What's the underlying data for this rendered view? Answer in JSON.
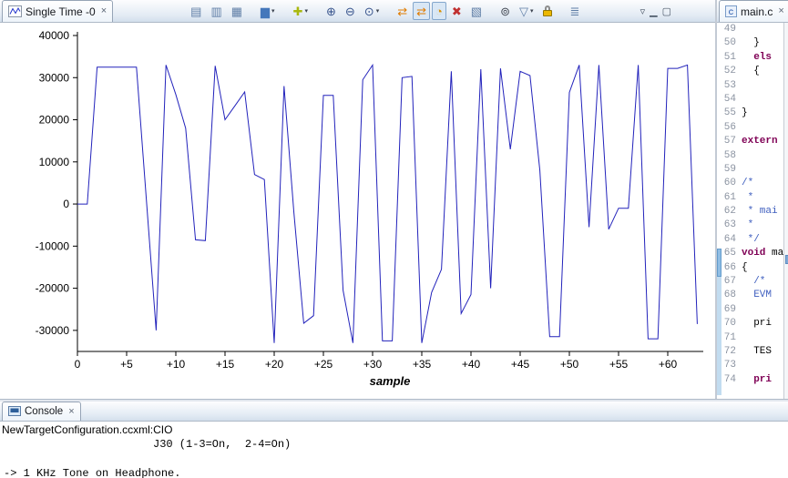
{
  "icons": {
    "close": "×",
    "dropdown": "▾"
  },
  "graph_pane": {
    "tab": {
      "label": "Single Time -0"
    },
    "toolbar": [
      {
        "name": "cursor-data-icon",
        "glyph": "▤",
        "color": "#5f7ea6"
      },
      {
        "name": "display-data-icon",
        "glyph": "▥",
        "color": "#5f7ea6"
      },
      {
        "name": "grid-toggle-icon",
        "glyph": "▦",
        "color": "#5f7ea6"
      },
      {
        "name": "signal-type-icon",
        "glyph": "▆",
        "color": "#4477bb",
        "dropdown": true,
        "gap": true
      },
      {
        "name": "add-graph-icon",
        "glyph": "✚",
        "color": "#a9b80e",
        "dropdown": true,
        "gap": true
      },
      {
        "name": "zoom-in-icon",
        "glyph": "⊕",
        "color": "#37538c",
        "gap": true
      },
      {
        "name": "zoom-out-icon",
        "glyph": "⊖",
        "color": "#37538c"
      },
      {
        "name": "zoom-mode-icon",
        "glyph": "⊙",
        "color": "#37538c",
        "dropdown": true
      },
      {
        "name": "refresh-icon",
        "glyph": "⇄",
        "color": "#e07b00",
        "gap": true
      },
      {
        "name": "continuous-refresh-icon",
        "glyph": "⇄",
        "color": "#e07b00",
        "pressed": true
      },
      {
        "name": "auto-scale-icon",
        "glyph": "◔",
        "color": "#d99000",
        "pressed": true
      },
      {
        "name": "clear-graph-icon",
        "glyph": "✖",
        "color": "#c03030"
      },
      {
        "name": "export-graph-icon",
        "glyph": "▧",
        "color": "#5f7ea6"
      },
      {
        "name": "search-icon",
        "glyph": "⊚",
        "color": "#444a55",
        "gap": true
      },
      {
        "name": "filter-icon",
        "glyph": "▽",
        "color": "#5f7ea6",
        "dropdown": true
      },
      {
        "name": "freeze-icon",
        "shape": "padlock"
      },
      {
        "name": "legend-icon",
        "glyph": "≣",
        "color": "#5f7ea6",
        "gap": true
      }
    ],
    "window_controls": [
      {
        "name": "view-menu-icon",
        "glyph": "▿"
      },
      {
        "name": "minimize-icon",
        "glyph": "▁"
      },
      {
        "name": "maximize-icon",
        "glyph": "▢"
      }
    ]
  },
  "chart_data": {
    "type": "line",
    "title": "",
    "xlabel": "sample",
    "ylabel": "",
    "grid": false,
    "legend": false,
    "line_color": "#2222bb",
    "xlim": [
      0,
      63
    ],
    "ylim": [
      -35000,
      40000
    ],
    "x_ticks": [
      {
        "v": 0,
        "label": "0"
      },
      {
        "v": 5,
        "label": "+5"
      },
      {
        "v": 10,
        "label": "+10"
      },
      {
        "v": 15,
        "label": "+15"
      },
      {
        "v": 20,
        "label": "+20"
      },
      {
        "v": 25,
        "label": "+25"
      },
      {
        "v": 30,
        "label": "+30"
      },
      {
        "v": 35,
        "label": "+35"
      },
      {
        "v": 40,
        "label": "+40"
      },
      {
        "v": 45,
        "label": "+45"
      },
      {
        "v": 50,
        "label": "+50"
      },
      {
        "v": 55,
        "label": "+55"
      },
      {
        "v": 60,
        "label": "+60"
      }
    ],
    "y_ticks": [
      40000,
      30000,
      20000,
      10000,
      0,
      -10000,
      -20000,
      -30000
    ],
    "x_start": 0,
    "values": [
      0,
      0,
      32500,
      32500,
      32500,
      32500,
      32500,
      1250,
      -30000,
      33000,
      26000,
      18000,
      -8500,
      -8700,
      32800,
      20000,
      23300,
      26600,
      7000,
      5800,
      -33000,
      28000,
      -2000,
      -28300,
      -26500,
      25800,
      25800,
      -20500,
      -33000,
      29500,
      33000,
      -32500,
      -32500,
      30000,
      30300,
      -33000,
      -21000,
      -15500,
      31500,
      -26000,
      -21500,
      32000,
      -20000,
      32200,
      13000,
      31500,
      30500,
      8000,
      -31500,
      -31500,
      26500,
      33000,
      -5500,
      33000,
      -6000,
      -1000,
      -1000,
      33000,
      -32000,
      -32000,
      32200,
      32200,
      33000,
      -28500
    ]
  },
  "editor_pane": {
    "tab": {
      "label": "main.c"
    },
    "start_line": 49,
    "range_indicator": {
      "start_line": 65,
      "marker_start": 65,
      "marker_end": 66
    },
    "styles": {
      "k": "keyword",
      "c": "comment",
      "p": "plain"
    },
    "lines": [
      {
        "segs": []
      },
      {
        "segs": [
          [
            "p",
            "  }"
          ]
        ]
      },
      {
        "segs": [
          [
            "p",
            "  "
          ],
          [
            "k",
            "els"
          ]
        ]
      },
      {
        "segs": [
          [
            "p",
            "  {"
          ]
        ]
      },
      {
        "segs": []
      },
      {
        "segs": []
      },
      {
        "segs": [
          [
            "p",
            "}"
          ]
        ]
      },
      {
        "segs": []
      },
      {
        "segs": [
          [
            "k",
            "extern"
          ]
        ]
      },
      {
        "segs": []
      },
      {
        "segs": []
      },
      {
        "segs": [
          [
            "c",
            "/*"
          ]
        ]
      },
      {
        "segs": [
          [
            "c",
            " *"
          ]
        ]
      },
      {
        "segs": [
          [
            "c",
            " * mai"
          ]
        ]
      },
      {
        "segs": [
          [
            "c",
            " *"
          ]
        ]
      },
      {
        "segs": [
          [
            "c",
            " */"
          ]
        ]
      },
      {
        "segs": [
          [
            "k",
            "void"
          ],
          [
            "p",
            " ma"
          ]
        ]
      },
      {
        "segs": [
          [
            "p",
            "{"
          ]
        ]
      },
      {
        "segs": [
          [
            "p",
            "  "
          ],
          [
            "c",
            "/*"
          ]
        ]
      },
      {
        "segs": [
          [
            "p",
            "  "
          ],
          [
            "c",
            "EVM"
          ]
        ]
      },
      {
        "segs": []
      },
      {
        "segs": [
          [
            "p",
            "  pri"
          ]
        ]
      },
      {
        "segs": []
      },
      {
        "segs": [
          [
            "p",
            "  TES"
          ]
        ]
      },
      {
        "segs": []
      },
      {
        "segs": [
          [
            "p",
            "  "
          ],
          [
            "k",
            "pri"
          ]
        ]
      }
    ]
  },
  "console_pane": {
    "tab": {
      "label": "Console"
    },
    "lines": [
      {
        "text": "NewTargetConfiguration.ccxml:CIO",
        "mono": false,
        "indent": 2
      },
      {
        "text": "J30 (1-3=On,  2-4=On)",
        "mono": true,
        "indent": 168
      },
      {
        "text": "",
        "mono": true,
        "indent": 0
      },
      {
        "text": "-> 1 KHz Tone on Headphone.",
        "mono": true,
        "indent": 4
      }
    ]
  }
}
